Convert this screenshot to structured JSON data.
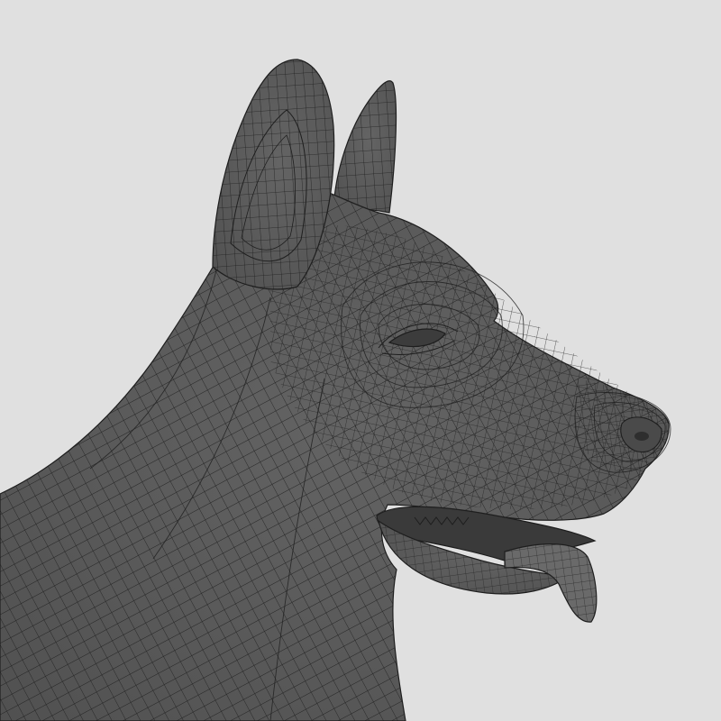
{
  "scene": {
    "subject": "dog-head-wireframe",
    "colors": {
      "background": "#e0e0e0",
      "surface": "#5b5b5b",
      "surface_dark": "#4a4a4a",
      "wire": "#1e1e1e",
      "tongue": "#6a6a6a"
    }
  }
}
